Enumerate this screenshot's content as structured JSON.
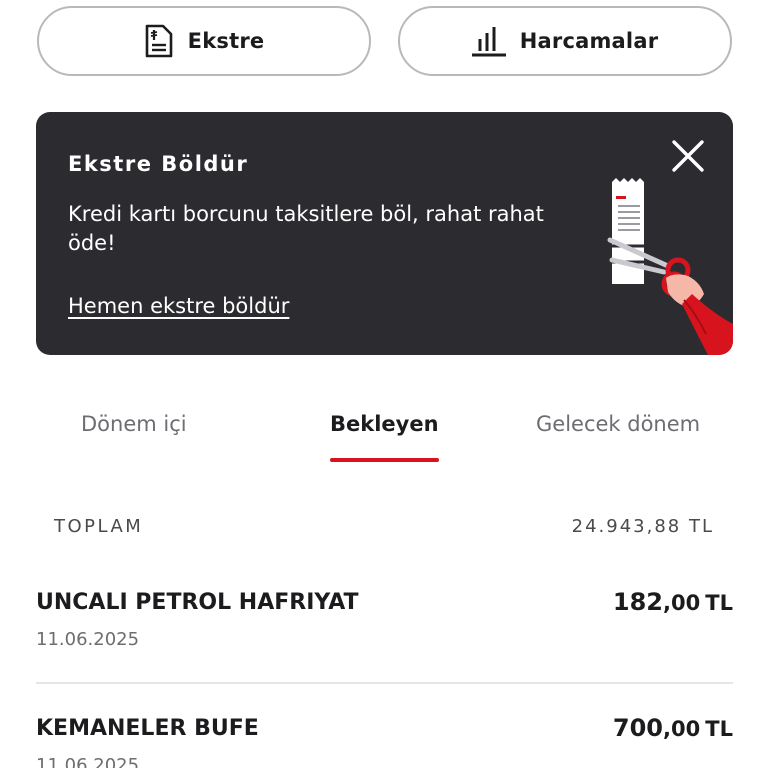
{
  "top_buttons": {
    "statement_label": "Ekstre",
    "spending_label": "Harcamalar"
  },
  "banner": {
    "title": "Ekstre Böldür",
    "text": "Kredi kartı borcunu taksitlere böl, rahat rahat öde!",
    "link": "Hemen ekstre böldür"
  },
  "tabs": [
    {
      "label": "Dönem içi",
      "active": false
    },
    {
      "label": "Bekleyen",
      "active": true
    },
    {
      "label": "Gelecek dönem",
      "active": false
    }
  ],
  "total": {
    "label": "TOPLAM",
    "value": "24.943,88 TL"
  },
  "transactions": [
    {
      "name": "UNCALI PETROL HAFRIYAT",
      "date": "11.06.2025",
      "amount_int": "182",
      "amount_dec": ",00",
      "currency": "TL"
    },
    {
      "name": "KEMANELER BUFE",
      "date": "11.06.2025",
      "amount_int": "700",
      "amount_dec": ",00",
      "currency": "TL"
    }
  ],
  "colors": {
    "accent": "#d7131e",
    "banner_bg": "#2c2b30",
    "text": "#1c1c1e",
    "muted": "#6d6d72"
  },
  "icons": {
    "statement": "lira-document-icon",
    "spending": "bar-chart-icon",
    "close": "close-icon"
  }
}
